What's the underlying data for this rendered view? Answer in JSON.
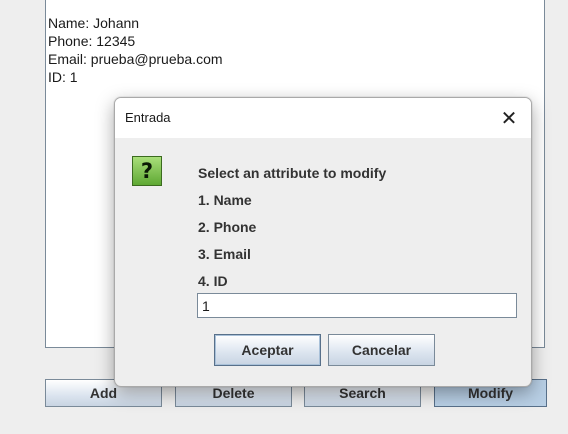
{
  "record": {
    "lines": [
      "Name: Johann",
      "Phone: 12345",
      "Email: prueba@prueba.com",
      "ID: 1"
    ]
  },
  "main_buttons": {
    "add": "Add",
    "delete": "Delete",
    "search": "Search",
    "modify": "Modify"
  },
  "dialog": {
    "title": "Entrada",
    "close_glyph": "✕",
    "icon_glyph": "?",
    "icon": "question-icon",
    "message": [
      "Select an attribute to modify",
      "1. Name",
      "2. Phone",
      "3. Email",
      "4. ID"
    ],
    "input_value": "1",
    "accept_label": "Aceptar",
    "cancel_label": "Cancelar"
  },
  "colors": {
    "icon_green": "#5ea833",
    "button_blue": "#dbe4ef",
    "selected_button": "#b8cfe5"
  }
}
